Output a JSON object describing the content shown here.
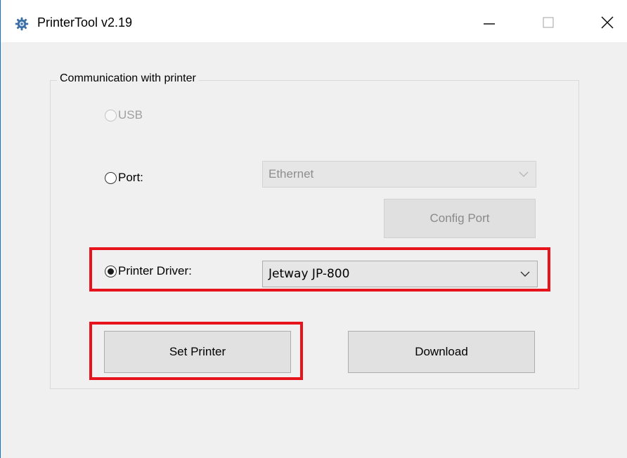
{
  "window": {
    "title": "PrinterTool v2.19",
    "app_icon": "gear-icon",
    "controls": [
      "minimize-icon",
      "maximize-icon",
      "close-icon"
    ]
  },
  "group": {
    "legend": "Communication with printer",
    "usb": {
      "label": "USB",
      "selected": false,
      "enabled": false
    },
    "port": {
      "label": "Port:",
      "selected": false,
      "combo_value": "Ethernet",
      "combo_enabled": false,
      "config_button_label": "Config Port",
      "config_button_enabled": false
    },
    "printer_driver": {
      "label": "Printer Driver:",
      "selected": true,
      "combo_value": "Jetway JP-800",
      "combo_enabled": true
    },
    "set_printer_label": "Set Printer",
    "download_label": "Download"
  },
  "annotations": {
    "highlight_color": "#e8141b"
  },
  "colors": {
    "window_bg": "#f0f0f0",
    "titlebar_bg": "#ffffff",
    "accent_border": "#1f6fc9"
  }
}
